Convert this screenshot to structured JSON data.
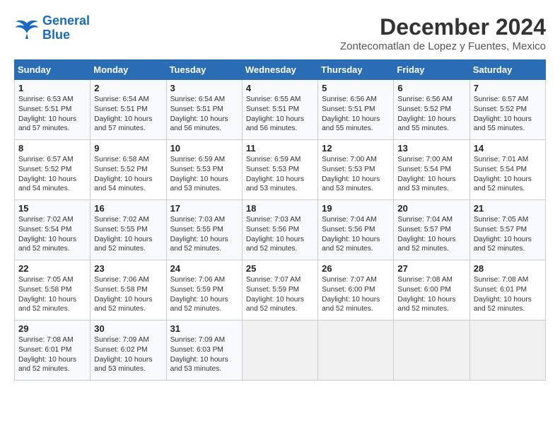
{
  "logo": {
    "line1": "General",
    "line2": "Blue"
  },
  "title": "December 2024",
  "subtitle": "Zontecomatlan de Lopez y Fuentes, Mexico",
  "days_header": [
    "Sunday",
    "Monday",
    "Tuesday",
    "Wednesday",
    "Thursday",
    "Friday",
    "Saturday"
  ],
  "weeks": [
    [
      {
        "day": "1",
        "info": "Sunrise: 6:53 AM\nSunset: 5:51 PM\nDaylight: 10 hours\nand 57 minutes."
      },
      {
        "day": "2",
        "info": "Sunrise: 6:54 AM\nSunset: 5:51 PM\nDaylight: 10 hours\nand 57 minutes."
      },
      {
        "day": "3",
        "info": "Sunrise: 6:54 AM\nSunset: 5:51 PM\nDaylight: 10 hours\nand 56 minutes."
      },
      {
        "day": "4",
        "info": "Sunrise: 6:55 AM\nSunset: 5:51 PM\nDaylight: 10 hours\nand 56 minutes."
      },
      {
        "day": "5",
        "info": "Sunrise: 6:56 AM\nSunset: 5:51 PM\nDaylight: 10 hours\nand 55 minutes."
      },
      {
        "day": "6",
        "info": "Sunrise: 6:56 AM\nSunset: 5:52 PM\nDaylight: 10 hours\nand 55 minutes."
      },
      {
        "day": "7",
        "info": "Sunrise: 6:57 AM\nSunset: 5:52 PM\nDaylight: 10 hours\nand 55 minutes."
      }
    ],
    [
      {
        "day": "8",
        "info": "Sunrise: 6:57 AM\nSunset: 5:52 PM\nDaylight: 10 hours\nand 54 minutes."
      },
      {
        "day": "9",
        "info": "Sunrise: 6:58 AM\nSunset: 5:52 PM\nDaylight: 10 hours\nand 54 minutes."
      },
      {
        "day": "10",
        "info": "Sunrise: 6:59 AM\nSunset: 5:53 PM\nDaylight: 10 hours\nand 53 minutes."
      },
      {
        "day": "11",
        "info": "Sunrise: 6:59 AM\nSunset: 5:53 PM\nDaylight: 10 hours\nand 53 minutes."
      },
      {
        "day": "12",
        "info": "Sunrise: 7:00 AM\nSunset: 5:53 PM\nDaylight: 10 hours\nand 53 minutes."
      },
      {
        "day": "13",
        "info": "Sunrise: 7:00 AM\nSunset: 5:54 PM\nDaylight: 10 hours\nand 53 minutes."
      },
      {
        "day": "14",
        "info": "Sunrise: 7:01 AM\nSunset: 5:54 PM\nDaylight: 10 hours\nand 52 minutes."
      }
    ],
    [
      {
        "day": "15",
        "info": "Sunrise: 7:02 AM\nSunset: 5:54 PM\nDaylight: 10 hours\nand 52 minutes."
      },
      {
        "day": "16",
        "info": "Sunrise: 7:02 AM\nSunset: 5:55 PM\nDaylight: 10 hours\nand 52 minutes."
      },
      {
        "day": "17",
        "info": "Sunrise: 7:03 AM\nSunset: 5:55 PM\nDaylight: 10 hours\nand 52 minutes."
      },
      {
        "day": "18",
        "info": "Sunrise: 7:03 AM\nSunset: 5:56 PM\nDaylight: 10 hours\nand 52 minutes."
      },
      {
        "day": "19",
        "info": "Sunrise: 7:04 AM\nSunset: 5:56 PM\nDaylight: 10 hours\nand 52 minutes."
      },
      {
        "day": "20",
        "info": "Sunrise: 7:04 AM\nSunset: 5:57 PM\nDaylight: 10 hours\nand 52 minutes."
      },
      {
        "day": "21",
        "info": "Sunrise: 7:05 AM\nSunset: 5:57 PM\nDaylight: 10 hours\nand 52 minutes."
      }
    ],
    [
      {
        "day": "22",
        "info": "Sunrise: 7:05 AM\nSunset: 5:58 PM\nDaylight: 10 hours\nand 52 minutes."
      },
      {
        "day": "23",
        "info": "Sunrise: 7:06 AM\nSunset: 5:58 PM\nDaylight: 10 hours\nand 52 minutes."
      },
      {
        "day": "24",
        "info": "Sunrise: 7:06 AM\nSunset: 5:59 PM\nDaylight: 10 hours\nand 52 minutes."
      },
      {
        "day": "25",
        "info": "Sunrise: 7:07 AM\nSunset: 5:59 PM\nDaylight: 10 hours\nand 52 minutes."
      },
      {
        "day": "26",
        "info": "Sunrise: 7:07 AM\nSunset: 6:00 PM\nDaylight: 10 hours\nand 52 minutes."
      },
      {
        "day": "27",
        "info": "Sunrise: 7:08 AM\nSunset: 6:00 PM\nDaylight: 10 hours\nand 52 minutes."
      },
      {
        "day": "28",
        "info": "Sunrise: 7:08 AM\nSunset: 6:01 PM\nDaylight: 10 hours\nand 52 minutes."
      }
    ],
    [
      {
        "day": "29",
        "info": "Sunrise: 7:08 AM\nSunset: 6:01 PM\nDaylight: 10 hours\nand 52 minutes."
      },
      {
        "day": "30",
        "info": "Sunrise: 7:09 AM\nSunset: 6:02 PM\nDaylight: 10 hours\nand 53 minutes."
      },
      {
        "day": "31",
        "info": "Sunrise: 7:09 AM\nSunset: 6:03 PM\nDaylight: 10 hours\nand 53 minutes."
      },
      null,
      null,
      null,
      null
    ]
  ]
}
